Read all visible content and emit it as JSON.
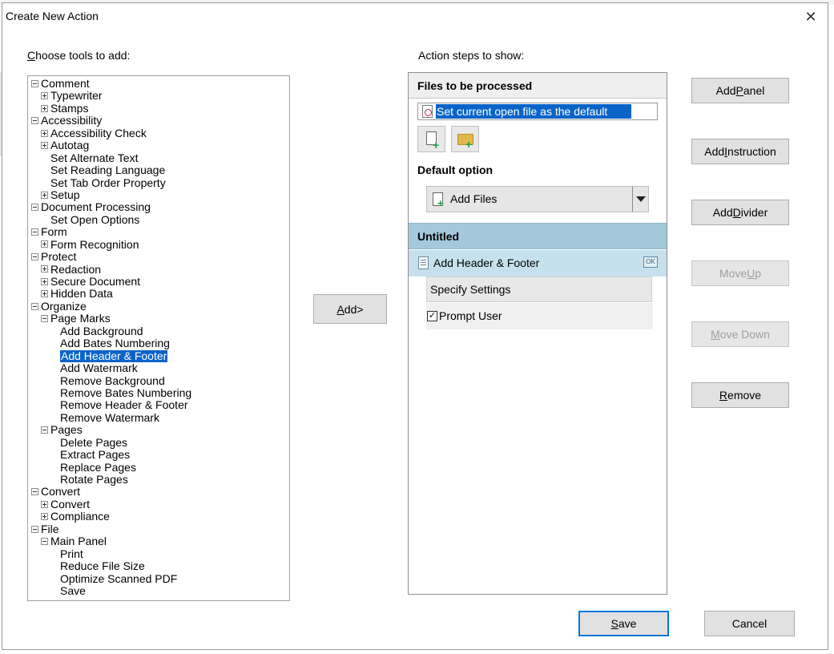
{
  "window": {
    "title": "Create New Action",
    "close_glyph": "✕"
  },
  "left": {
    "label_prefix": "",
    "label_u": "C",
    "label_rest": "hoose tools to add:",
    "tree": [
      {
        "text": "Comment",
        "depth": 0,
        "toggle": "minus"
      },
      {
        "text": "Typewriter",
        "depth": 1,
        "toggle": "plus"
      },
      {
        "text": "Stamps",
        "depth": 1,
        "toggle": "plus"
      },
      {
        "text": "Accessibility",
        "depth": 0,
        "toggle": "minus"
      },
      {
        "text": "Accessibility Check",
        "depth": 1,
        "toggle": "plus"
      },
      {
        "text": "Autotag",
        "depth": 1,
        "toggle": "plus"
      },
      {
        "text": "Set Alternate Text",
        "depth": 1,
        "toggle": "none"
      },
      {
        "text": "Set Reading Language",
        "depth": 1,
        "toggle": "none"
      },
      {
        "text": "Set Tab Order Property",
        "depth": 1,
        "toggle": "none"
      },
      {
        "text": "Setup",
        "depth": 1,
        "toggle": "plus"
      },
      {
        "text": "Document Processing",
        "depth": 0,
        "toggle": "minus"
      },
      {
        "text": "Set Open Options",
        "depth": 1,
        "toggle": "none"
      },
      {
        "text": "Form",
        "depth": 0,
        "toggle": "minus"
      },
      {
        "text": "Form Recognition",
        "depth": 1,
        "toggle": "plus"
      },
      {
        "text": "Protect",
        "depth": 0,
        "toggle": "minus"
      },
      {
        "text": "Redaction",
        "depth": 1,
        "toggle": "plus"
      },
      {
        "text": "Secure Document",
        "depth": 1,
        "toggle": "plus"
      },
      {
        "text": "Hidden Data",
        "depth": 1,
        "toggle": "plus"
      },
      {
        "text": "Organize",
        "depth": 0,
        "toggle": "minus"
      },
      {
        "text": "Page Marks",
        "depth": 1,
        "toggle": "minus"
      },
      {
        "text": "Add Background",
        "depth": 2,
        "toggle": "none"
      },
      {
        "text": "Add Bates Numbering",
        "depth": 2,
        "toggle": "none"
      },
      {
        "text": "Add Header & Footer",
        "depth": 2,
        "toggle": "none",
        "selected": true
      },
      {
        "text": "Add Watermark",
        "depth": 2,
        "toggle": "none"
      },
      {
        "text": "Remove Background",
        "depth": 2,
        "toggle": "none"
      },
      {
        "text": "Remove Bates Numbering",
        "depth": 2,
        "toggle": "none"
      },
      {
        "text": "Remove Header & Footer",
        "depth": 2,
        "toggle": "none"
      },
      {
        "text": "Remove Watermark",
        "depth": 2,
        "toggle": "none"
      },
      {
        "text": "Pages",
        "depth": 1,
        "toggle": "minus"
      },
      {
        "text": "Delete Pages",
        "depth": 2,
        "toggle": "none"
      },
      {
        "text": "Extract Pages",
        "depth": 2,
        "toggle": "none"
      },
      {
        "text": "Replace Pages",
        "depth": 2,
        "toggle": "none"
      },
      {
        "text": "Rotate Pages",
        "depth": 2,
        "toggle": "none"
      },
      {
        "text": "Convert",
        "depth": 0,
        "toggle": "minus"
      },
      {
        "text": "Convert",
        "depth": 1,
        "toggle": "plus"
      },
      {
        "text": "Compliance",
        "depth": 1,
        "toggle": "plus"
      },
      {
        "text": "File",
        "depth": 0,
        "toggle": "minus"
      },
      {
        "text": "Main Panel",
        "depth": 1,
        "toggle": "minus"
      },
      {
        "text": "Print",
        "depth": 2,
        "toggle": "none"
      },
      {
        "text": "Reduce File Size",
        "depth": 2,
        "toggle": "none"
      },
      {
        "text": "Optimize Scanned PDF",
        "depth": 2,
        "toggle": "none"
      },
      {
        "text": "Save",
        "depth": 2,
        "toggle": "none"
      }
    ]
  },
  "middle": {
    "add_u": "A",
    "add_rest": "dd>"
  },
  "right": {
    "label": "Action steps to show:",
    "files_header": "Files to be processed",
    "file_entry": "Set current open file as the default",
    "default_option_label": "Default option",
    "default_option_value": "Add Files",
    "group_header": "Untitled",
    "step_label": "Add Header & Footer",
    "ok_badge": "OK",
    "specify_settings": "Specify Settings",
    "prompt_user": "Prompt User",
    "prompt_checked": true,
    "checkmark": "✓",
    "plus_glyph": "+"
  },
  "buttons": {
    "add_panel": {
      "pre": "Add ",
      "u": "P",
      "post": "anel"
    },
    "add_instruction": {
      "pre": "Add ",
      "u": "I",
      "post": "nstruction"
    },
    "add_divider": {
      "pre": "Add ",
      "u": "D",
      "post": "ivider"
    },
    "move_up": {
      "pre": "Move ",
      "u": "U",
      "post": "p"
    },
    "move_down": {
      "pre": "",
      "u": "M",
      "post": "ove Down"
    },
    "remove": {
      "pre": "",
      "u": "R",
      "post": "emove"
    },
    "save": {
      "pre": "",
      "u": "S",
      "post": "ave"
    },
    "cancel": {
      "pre": "Cancel",
      "u": "",
      "post": ""
    }
  }
}
